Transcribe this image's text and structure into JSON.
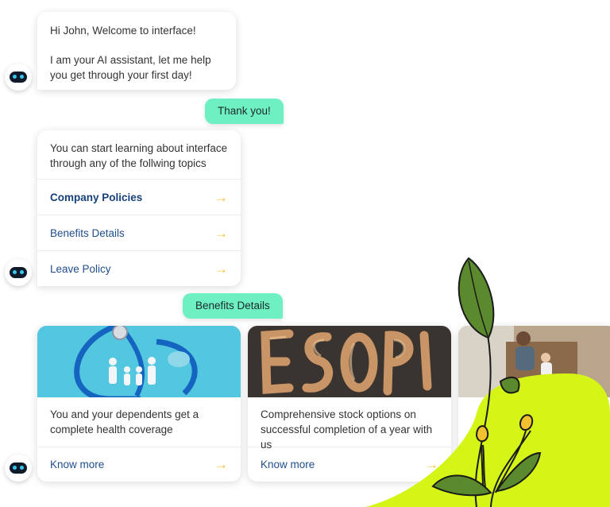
{
  "messages": {
    "welcome": {
      "line1": "Hi John, Welcome to interface!",
      "line2": "I am your AI assistant, let me help you get through your first day!"
    },
    "user_reply_1": "Thank you!",
    "topics_intro": "You can start learning about interface through any of the follwing topics",
    "topics": [
      {
        "label": "Company Policies"
      },
      {
        "label": "Benefits Details"
      },
      {
        "label": "Leave Policy"
      }
    ],
    "user_reply_2": "Benefits Details"
  },
  "cards": [
    {
      "text": "You and your dependents get a complete health coverage",
      "link": "Know more"
    },
    {
      "text": "Comprehensive stock options on successful completion of a year with us",
      "link": "Know more"
    }
  ],
  "icons": {
    "arrow": "→",
    "bot": "bot-avatar-icon"
  },
  "colors": {
    "user_bubble": "#6ff0c2",
    "link": "#1f4e8c",
    "arrow": "#f2c12e",
    "blob": "#d4f515",
    "leaf": "#5b8a2e"
  }
}
